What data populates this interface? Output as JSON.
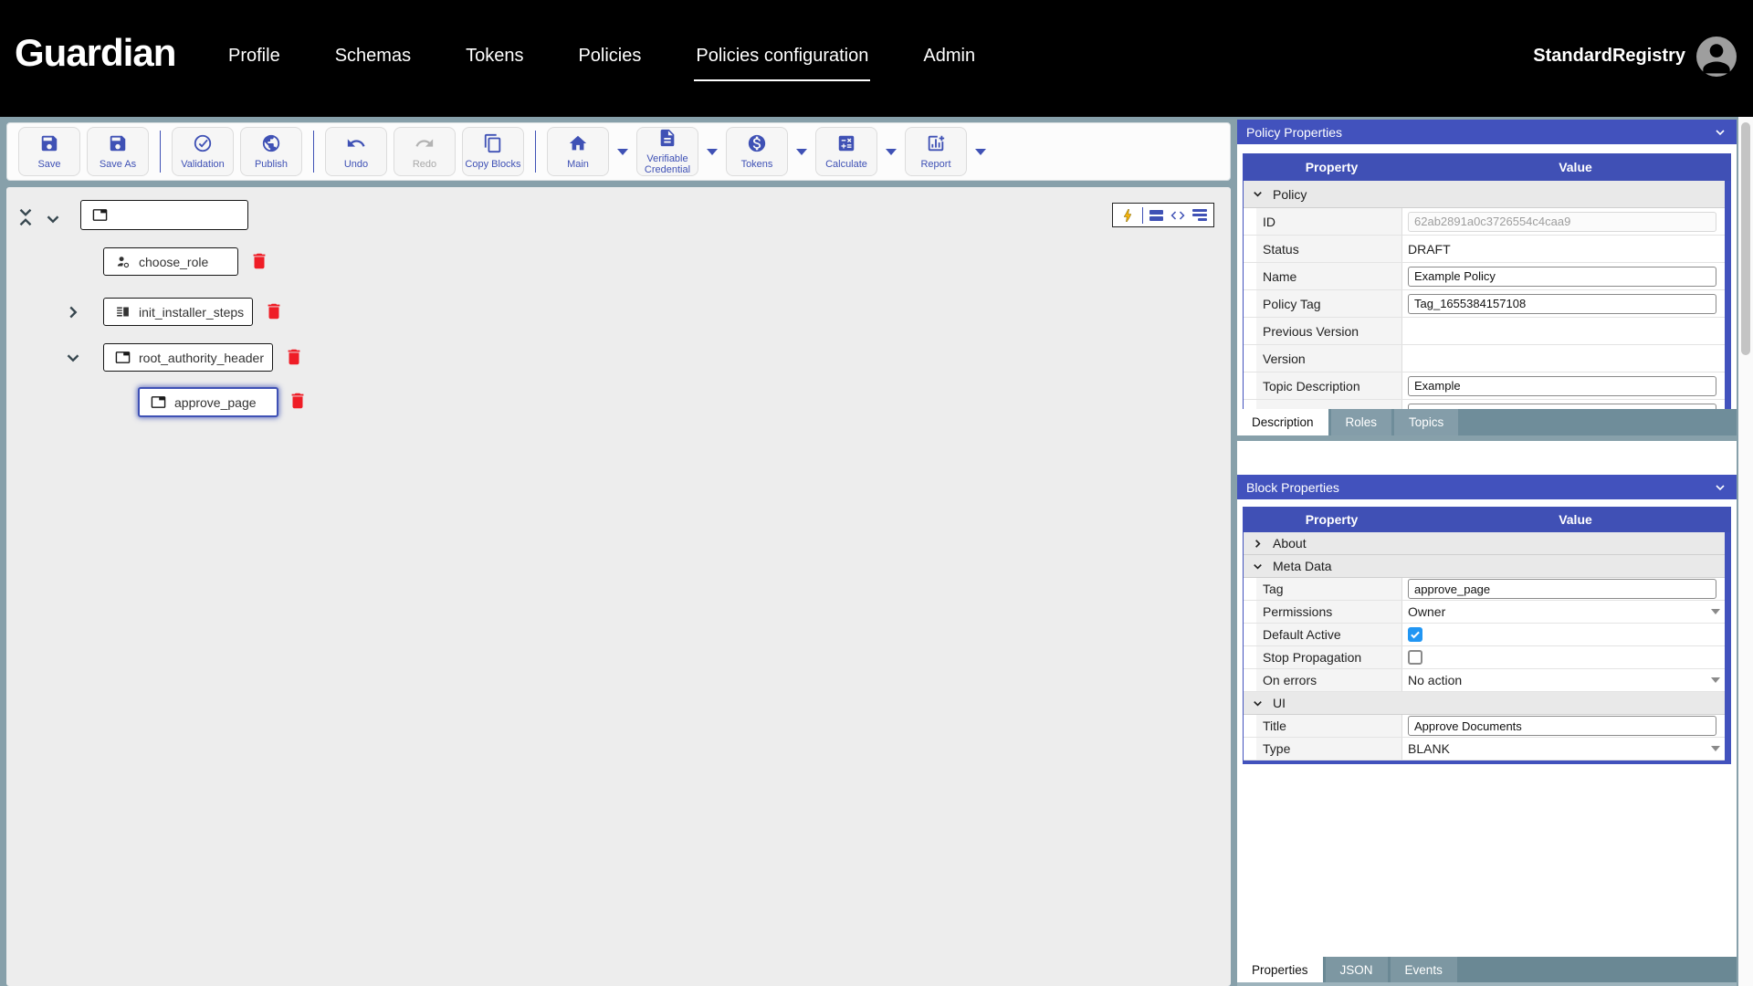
{
  "nav": {
    "brand": "Guardian",
    "items": [
      "Profile",
      "Schemas",
      "Tokens",
      "Policies",
      "Policies configuration",
      "Admin"
    ],
    "active_item": "Policies configuration",
    "user_name": "StandardRegistry"
  },
  "toolbar": {
    "save": "Save",
    "save_as": "Save As",
    "validation": "Validation",
    "publish": "Publish",
    "undo": "Undo",
    "redo": "Redo",
    "copy_blocks": "Copy Blocks",
    "main": "Main",
    "verifiable_credential": "Verifiable Credential",
    "tokens": "Tokens",
    "calculate": "Calculate",
    "report": "Report"
  },
  "tree": {
    "nodes": [
      {
        "label": "choose_role",
        "icon": "manage-accounts-icon",
        "selected": false
      },
      {
        "label": "init_installer_steps",
        "icon": "vertical-split-icon",
        "selected": false
      },
      {
        "label": "root_authority_header",
        "icon": "tab-icon",
        "selected": false
      },
      {
        "label": "approve_page",
        "icon": "tab-icon",
        "selected": true
      }
    ]
  },
  "policy_properties": {
    "title": "Policy Properties",
    "col_property": "Property",
    "col_value": "Value",
    "group": "Policy",
    "rows": {
      "id": {
        "label": "ID",
        "value": "62ab2891a0c3726554c4caa9"
      },
      "status": {
        "label": "Status",
        "value": "DRAFT"
      },
      "name": {
        "label": "Name",
        "value": "Example Policy"
      },
      "policy_tag": {
        "label": "Policy Tag",
        "value": "Tag_1655384157108"
      },
      "previous_version": {
        "label": "Previous Version",
        "value": ""
      },
      "version": {
        "label": "Version",
        "value": ""
      },
      "topic_description": {
        "label": "Topic Description",
        "value": "Example"
      }
    },
    "tabs": {
      "description": "Description",
      "roles": "Roles",
      "topics": "Topics",
      "active": "Description"
    }
  },
  "block_properties": {
    "title": "Block Properties",
    "col_property": "Property",
    "col_value": "Value",
    "sections": {
      "about": "About",
      "meta_data": "Meta Data",
      "ui": "UI"
    },
    "rows": {
      "tag": {
        "label": "Tag",
        "value": "approve_page"
      },
      "permissions": {
        "label": "Permissions",
        "value": "Owner"
      },
      "default_active": {
        "label": "Default Active",
        "checked": true
      },
      "stop_propagation": {
        "label": "Stop Propagation",
        "checked": false
      },
      "on_errors": {
        "label": "On errors",
        "value": "No action"
      },
      "title_row": {
        "label": "Title",
        "value": "Approve Documents"
      },
      "type_row": {
        "label": "Type",
        "value": "BLANK"
      }
    }
  },
  "bottom_tabs": {
    "properties": "Properties",
    "json": "JSON",
    "events": "Events",
    "active": "Properties"
  },
  "colors": {
    "nav_bg": "#000000",
    "body_bg": "#87a0aa",
    "accent": "#4252bd",
    "toolbar_icon": "#3f51b5",
    "checkbox_checked": "#2196f3",
    "danger": "#ef1d26",
    "bolt": "#f6b40e"
  }
}
